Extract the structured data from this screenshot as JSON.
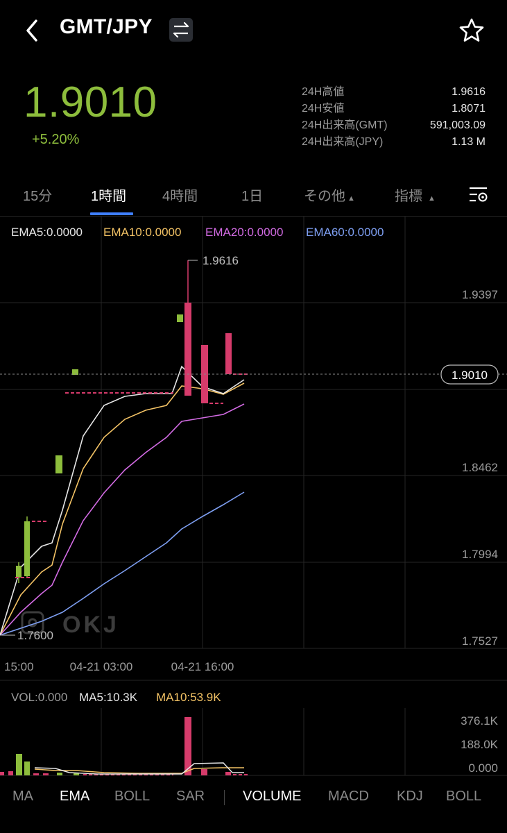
{
  "header": {
    "title": "GMT/JPY",
    "back_icon": "chevron-left-icon",
    "swap_icon": "swap-arrows-icon",
    "favorite_icon": "star-outline-icon"
  },
  "ticker": {
    "price": "1.9010",
    "change": "+5.20%",
    "color_up": "#8dbd3c",
    "color_down": "#d63b6b"
  },
  "stats": [
    {
      "label": "24H高値",
      "value": "1.9616"
    },
    {
      "label": "24H安値",
      "value": "1.8071"
    },
    {
      "label": "24H出来高(GMT)",
      "value": "591,003.09"
    },
    {
      "label": "24H出来高(JPY)",
      "value": "1.13 M"
    }
  ],
  "timeframe_tabs": [
    {
      "label": "15分",
      "active": false
    },
    {
      "label": "1時間",
      "active": true
    },
    {
      "label": "4時間",
      "active": false
    },
    {
      "label": "1日",
      "active": false
    },
    {
      "label": "その他",
      "active": false
    },
    {
      "label": "指標",
      "active": false
    }
  ],
  "chart_settings_icon": "chart-settings-icon",
  "ema_legend": [
    {
      "label": "EMA5:0.0000",
      "color": "#e6e6e6"
    },
    {
      "label": "EMA10:0.0000",
      "color": "#f2c265"
    },
    {
      "label": "EMA20:0.0000",
      "color": "#d26be3"
    },
    {
      "label": "EMA60:0.0000",
      "color": "#7e9ff2"
    }
  ],
  "chart_data": {
    "type": "candlestick",
    "price_axis": [
      "1.9397",
      "1.8462",
      "1.7994",
      "1.7527"
    ],
    "ylim": [
      1.7527,
      1.9631
    ],
    "time_axis": [
      "15:00",
      "04-21 03:00",
      "04-21 16:00"
    ],
    "high_label": "1.9616",
    "low_label": "1.7600",
    "current_price_label": "1.9010",
    "watermark": "OKJ"
  },
  "volume_legend": [
    {
      "label": "VOL:0.000",
      "color": "#9c9c9c"
    },
    {
      "label": "MA5:10.3K",
      "color": "#e6e6e6"
    },
    {
      "label": "MA10:53.9K",
      "color": "#f2c265"
    }
  ],
  "volume_axis": [
    "376.1K",
    "188.0K",
    "0.000"
  ],
  "bottom_tabs": [
    {
      "label": "MA",
      "active": false
    },
    {
      "label": "EMA",
      "active": true
    },
    {
      "label": "BOLL",
      "active": false
    },
    {
      "label": "SAR",
      "active": false
    },
    {
      "label": "VOLUME",
      "active": true
    },
    {
      "label": "MACD",
      "active": false
    },
    {
      "label": "KDJ",
      "active": false
    },
    {
      "label": "BOLL",
      "active": false
    }
  ]
}
